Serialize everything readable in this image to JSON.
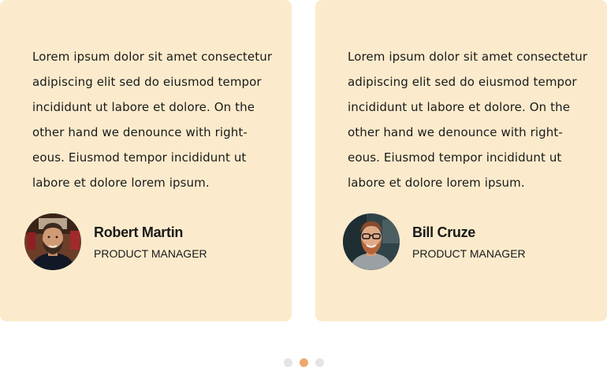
{
  "testimonials": [
    {
      "quote_lines": [
        "Lorem ipsum dolor sit amet consectetur",
        "adipiscing elit sed do eiusmod tempor",
        "incididunt ut labore et dolore. On the",
        "other hand we denounce with right-",
        "eous. Eiusmod tempor incididunt ut",
        "labore et dolore lorem ipsum."
      ],
      "name": "Robert Martin",
      "role": "PRODUCT MANAGER"
    },
    {
      "quote_lines": [
        "Lorem ipsum dolor sit amet consectetur",
        "adipiscing elit sed do eiusmod tempor",
        "incididunt ut labore et dolore. On the",
        "other hand we denounce with right-",
        "eous. Eiusmod tempor incididunt ut",
        "labore et dolore lorem ipsum."
      ],
      "name": "Bill Cruze",
      "role": "PRODUCT MANAGER"
    }
  ],
  "pagination": {
    "active_index": 1
  },
  "colors": {
    "card_bg": "#fbebcc",
    "dot_active": "#f0a86a",
    "dot_inactive": "#e4e3e6"
  }
}
